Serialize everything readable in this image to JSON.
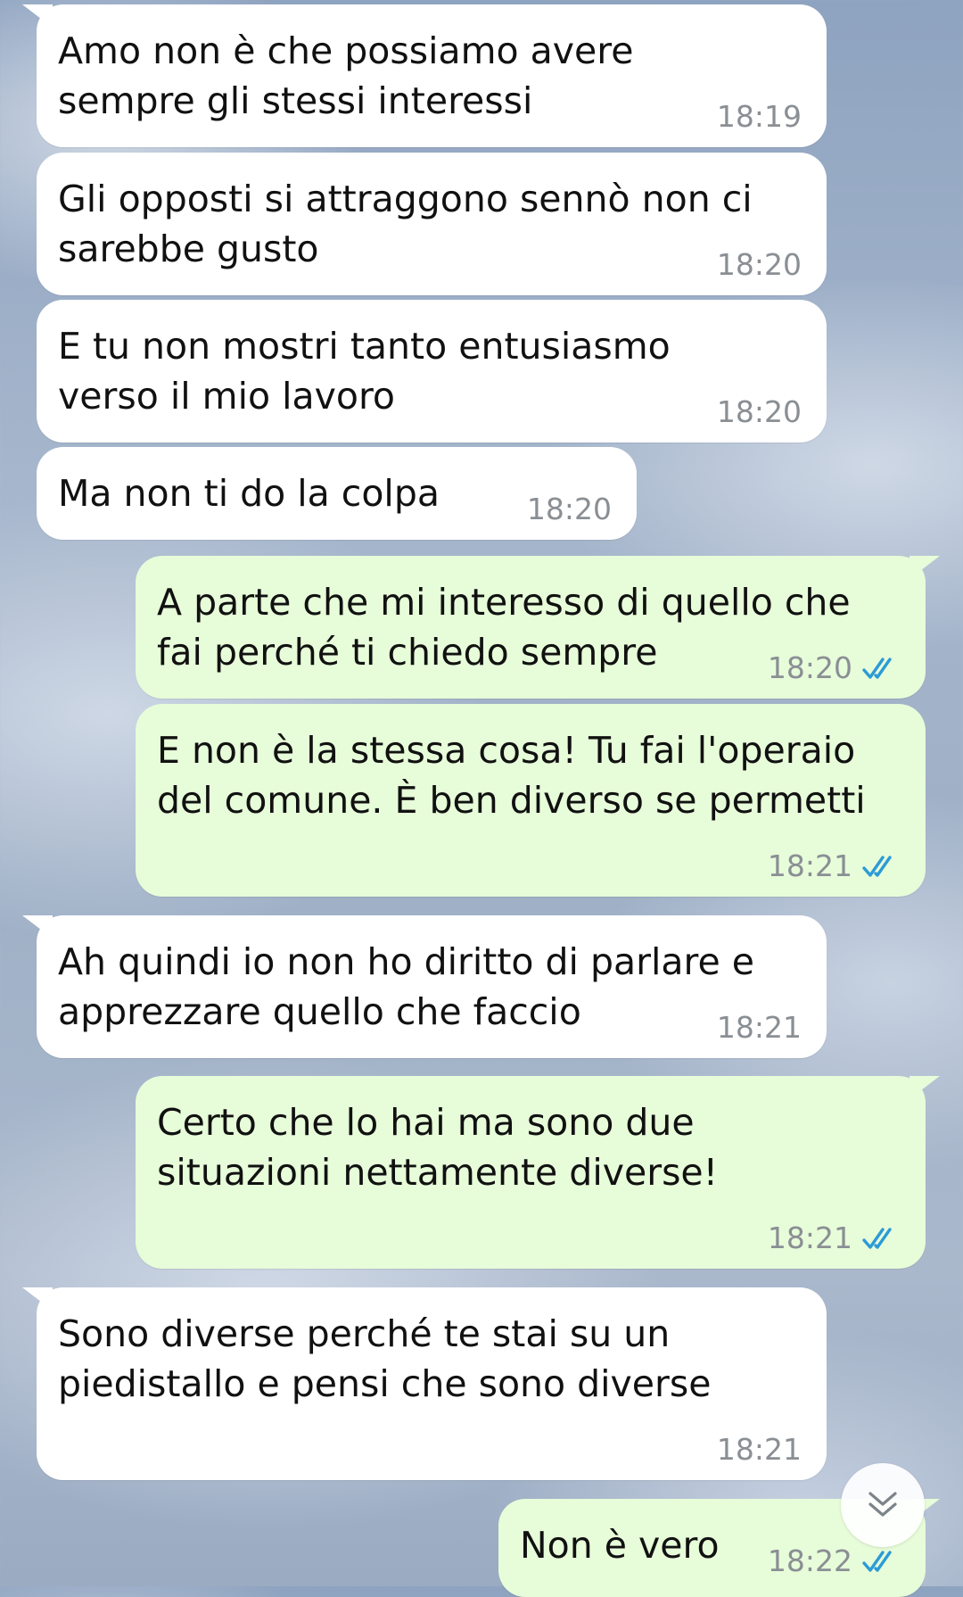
{
  "messages": [
    {
      "id": 1,
      "direction": "incoming",
      "text": "Amo non è che possiamo avere\nsempre gli stessi interessi",
      "time": "18:19"
    },
    {
      "id": 2,
      "direction": "incoming",
      "text": "Gli opposti si attraggono sennò non ci\nsarebbe gusto",
      "time": "18:20"
    },
    {
      "id": 3,
      "direction": "incoming",
      "text": "E tu non mostri tanto entusiasmo\nverso il mio lavoro",
      "time": "18:20"
    },
    {
      "id": 4,
      "direction": "incoming",
      "text": "Ma non ti do la colpa",
      "time": "18:20"
    },
    {
      "id": 5,
      "direction": "outgoing",
      "text": "A parte che mi interesso di quello che\nfai perché ti chiedo sempre",
      "time": "18:20",
      "status": "read"
    },
    {
      "id": 6,
      "direction": "outgoing",
      "text": "E non è la stessa cosa! Tu fai l'operaio\ndel comune. È ben diverso se permetti",
      "time": "18:21",
      "status": "read"
    },
    {
      "id": 7,
      "direction": "incoming",
      "text": "Ah quindi io non ho diritto di parlare e\napprezzare quello che faccio",
      "time": "18:21"
    },
    {
      "id": 8,
      "direction": "outgoing",
      "text": "Certo che lo hai ma sono due\nsituazioni nettamente diverse!",
      "time": "18:21",
      "status": "read"
    },
    {
      "id": 9,
      "direction": "incoming",
      "text": "Sono diverse perché te stai su un\npiedistallo e pensi che sono diverse",
      "time": "18:21"
    },
    {
      "id": 10,
      "direction": "outgoing",
      "text": "Non è vero",
      "time": "18:22",
      "status": "read"
    }
  ],
  "scroll_button": {
    "icon": "double-chevron-down-icon"
  },
  "colors": {
    "incoming_bubble": "#ffffff",
    "outgoing_bubble": "#e7fcd9",
    "timestamp": "#8a8f94",
    "read_ticks": "#2c9bd6",
    "text": "#111111"
  }
}
